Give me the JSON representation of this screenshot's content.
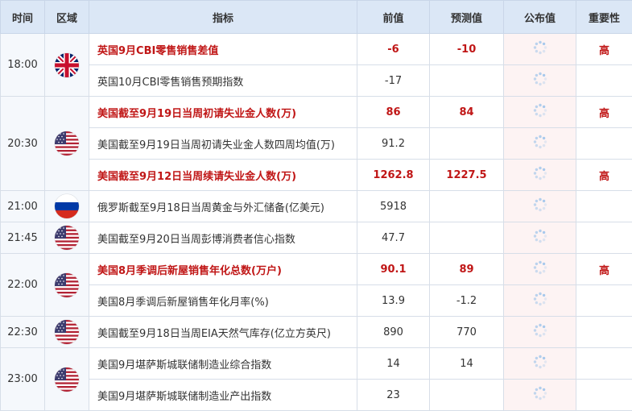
{
  "header": {
    "time": "时间",
    "region": "区域",
    "indicator": "指标",
    "previous": "前值",
    "forecast": "预测值",
    "published": "公布值",
    "importance": "重要性"
  },
  "groups": [
    {
      "time": "18:00",
      "flag": "uk-flag-icon",
      "rows": [
        {
          "indicator": "英国9月CBI零售销售差值",
          "previous": "-6",
          "forecast": "-10",
          "importance": "高",
          "hot": true
        },
        {
          "indicator": "英国10月CBI零售销售预期指数",
          "previous": "-17",
          "forecast": "",
          "importance": "",
          "hot": false
        }
      ]
    },
    {
      "time": "20:30",
      "flag": "us-flag-icon",
      "rows": [
        {
          "indicator": "美国截至9月19日当周初请失业金人数(万)",
          "previous": "86",
          "forecast": "84",
          "importance": "高",
          "hot": true
        },
        {
          "indicator": "美国截至9月19日当周初请失业金人数四周均值(万)",
          "previous": "91.2",
          "forecast": "",
          "importance": "",
          "hot": false
        },
        {
          "indicator": "美国截至9月12日当周续请失业金人数(万)",
          "previous": "1262.8",
          "forecast": "1227.5",
          "importance": "高",
          "hot": true
        }
      ]
    },
    {
      "time": "21:00",
      "flag": "russia-flag-icon",
      "rows": [
        {
          "indicator": "俄罗斯截至9月18日当周黄金与外汇储备(亿美元)",
          "previous": "5918",
          "forecast": "",
          "importance": "",
          "hot": false
        }
      ]
    },
    {
      "time": "21:45",
      "flag": "us-flag-icon",
      "rows": [
        {
          "indicator": "美国截至9月20日当周彭博消费者信心指数",
          "previous": "47.7",
          "forecast": "",
          "importance": "",
          "hot": false
        }
      ]
    },
    {
      "time": "22:00",
      "flag": "us-flag-icon",
      "rows": [
        {
          "indicator": "美国8月季调后新屋销售年化总数(万户)",
          "previous": "90.1",
          "forecast": "89",
          "importance": "高",
          "hot": true
        },
        {
          "indicator": "美国8月季调后新屋销售年化月率(%)",
          "previous": "13.9",
          "forecast": "-1.2",
          "importance": "",
          "hot": false
        }
      ]
    },
    {
      "time": "22:30",
      "flag": "us-flag-icon",
      "rows": [
        {
          "indicator": "美国截至9月18日当周EIA天然气库存(亿立方英尺)",
          "previous": "890",
          "forecast": "770",
          "importance": "",
          "hot": false
        }
      ]
    },
    {
      "time": "23:00",
      "flag": "us-flag-icon",
      "rows": [
        {
          "indicator": "美国9月堪萨斯城联储制造业综合指数",
          "previous": "14",
          "forecast": "14",
          "importance": "",
          "hot": false
        },
        {
          "indicator": "美国9月堪萨斯城联储制造业产出指数",
          "previous": "23",
          "forecast": "",
          "importance": "",
          "hot": false
        }
      ]
    }
  ]
}
